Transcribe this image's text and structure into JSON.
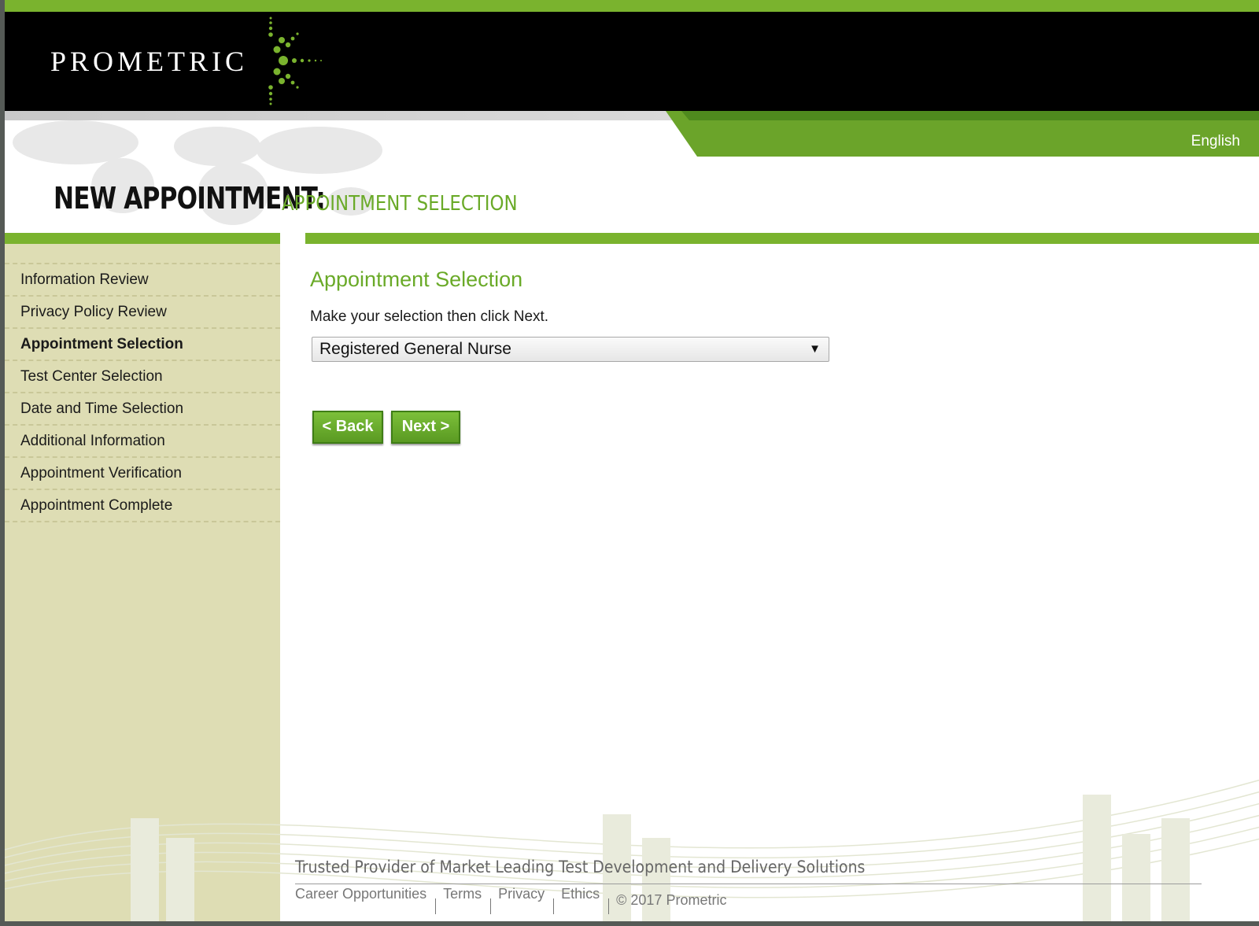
{
  "brand": {
    "name": "PROMETRIC"
  },
  "language": {
    "label": "English"
  },
  "page": {
    "title": "NEW APPOINTMENT:",
    "subtitle": "APPOINTMENT SELECTION"
  },
  "sidebar": {
    "items": [
      {
        "label": "Information Review",
        "active": false
      },
      {
        "label": "Privacy Policy Review",
        "active": false
      },
      {
        "label": "Appointment Selection",
        "active": true
      },
      {
        "label": "Test Center Selection",
        "active": false
      },
      {
        "label": "Date and Time Selection",
        "active": false
      },
      {
        "label": "Additional Information",
        "active": false
      },
      {
        "label": "Appointment Verification",
        "active": false
      },
      {
        "label": "Appointment Complete",
        "active": false
      }
    ]
  },
  "content": {
    "heading": "Appointment Selection",
    "instruction": "Make your selection then click Next.",
    "select": {
      "value": "Registered General Nurse",
      "arrow": "▼"
    },
    "back_label": "< Back",
    "next_label": "Next >"
  },
  "footer": {
    "tagline": "Trusted Provider of Market Leading Test Development and Delivery Solutions",
    "links": [
      "Career Opportunities",
      "Terms",
      "Privacy",
      "Ethics"
    ],
    "copyright": "© 2017 Prometric"
  },
  "colors": {
    "accent_green": "#7ab32e",
    "header_black": "#000000",
    "sidebar_bg": "#deddb4",
    "title_green": "#6aaa28"
  }
}
